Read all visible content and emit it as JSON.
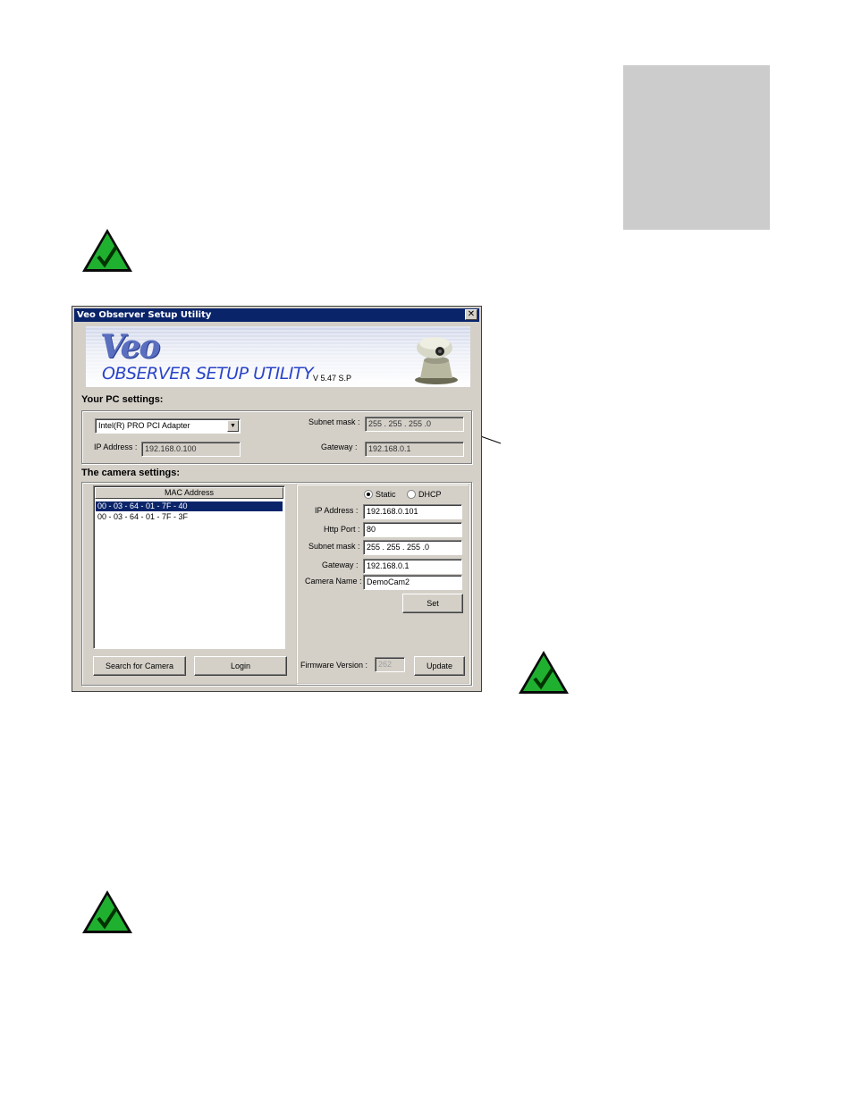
{
  "dialog": {
    "title": "Veo Observer Setup Utility",
    "close_glyph": "✕",
    "banner": {
      "logo": "Veo",
      "product": "OBSERVER SETUP UTILITY",
      "version": "V 5.47 S.P"
    },
    "pc_settings": {
      "heading": "Your PC settings:",
      "adapter": "Intel(R) PRO PCI Adapter",
      "ip_label": "IP Address :",
      "ip_value": "192.168.0.100",
      "subnet_label": "Subnet mask :",
      "subnet_value": "255  .  255  .  255  .0",
      "gateway_label": "Gateway :",
      "gateway_value": "192.168.0.1"
    },
    "camera_settings": {
      "heading": "The camera settings:",
      "list_header": "MAC Address",
      "mac_list": [
        "00 - 03 - 64 - 01 - 7F - 40",
        "00 - 03 - 64 - 01 - 7F - 3F"
      ],
      "mode_static": "Static",
      "mode_dhcp": "DHCP",
      "ip_label": "IP Address :",
      "ip_value": "192.168.0.101",
      "port_label": "Http Port :",
      "port_value": "80",
      "subnet_label": "Subnet mask :",
      "subnet_value": "255  .  255  .  255  .0",
      "gateway_label": "Gateway :",
      "gateway_value": "192.168.0.1",
      "name_label": "Camera Name :",
      "name_value": "DemoCam2",
      "set_button": "Set",
      "firmware_label": "Firmware Version :",
      "firmware_value": "262",
      "update_button": "Update",
      "search_button": "Search for Camera",
      "login_button": "Login"
    }
  }
}
